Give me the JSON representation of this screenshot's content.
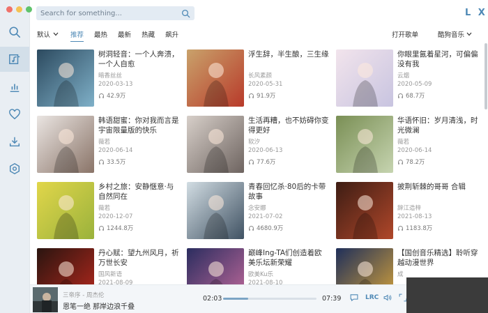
{
  "window": {
    "controls": [
      "#f0726a",
      "#f5c254",
      "#5fc36b"
    ]
  },
  "app_logo": "L X",
  "search": {
    "placeholder": "Search for something..."
  },
  "sidebar": {
    "items": [
      "search-icon",
      "music-list-icon",
      "chart-icon",
      "heart-icon",
      "download-icon",
      "settings-icon"
    ],
    "active": 1
  },
  "sort": {
    "default_label": "默认",
    "tabs": [
      "推荐",
      "最热",
      "最新",
      "热藏",
      "飙升"
    ],
    "active": 0
  },
  "top_right": {
    "open_playlist": "打开歌单",
    "source": "酷狗音乐"
  },
  "cards": [
    {
      "title": "树洞轻音：一个人奔溃，一个人自愈",
      "author": "暗香丝丝",
      "date": "2020-03-13",
      "plays": "42.9万",
      "colors": [
        "#2c4a5f",
        "#7fb0c8"
      ]
    },
    {
      "title": "浮生辞，半生酿，三生缘",
      "author": "长风素颜",
      "date": "2020-05-31",
      "plays": "91.9万",
      "colors": [
        "#c9a26b",
        "#b83a2a"
      ]
    },
    {
      "title": "你眼里氤着星河，可偏偏没有我",
      "author": "云烟",
      "date": "2020-05-09",
      "plays": "68.7万",
      "colors": [
        "#f2e4ec",
        "#c8c4e0"
      ]
    },
    {
      "title": "韩语甜蜜：你对我而言是宇宙限量版的快乐",
      "author": "薇若",
      "date": "2020-06-14",
      "plays": "33.5万",
      "colors": [
        "#eae5e2",
        "#8a7468"
      ]
    },
    {
      "title": "生活再糟，也不妨碍你变得更好",
      "author": "软汐",
      "date": "2020-06-13",
      "plays": "77.6万",
      "colors": [
        "#d7cfc9",
        "#6e6460"
      ]
    },
    {
      "title": "华语怀旧：岁月清浅，时光微澜",
      "author": "薇若",
      "date": "2020-06-14",
      "plays": "78.2万",
      "colors": [
        "#7a8f55",
        "#c6d4b0"
      ]
    },
    {
      "title": "乡村之旅：安静惬意·与自然同在",
      "author": "薇若",
      "date": "2020-12-07",
      "plays": "1244.8万",
      "colors": [
        "#e1d64a",
        "#9ab23c"
      ]
    },
    {
      "title": "青春回忆杀·80后的卡带故事",
      "author": "念安娜",
      "date": "2021-07-02",
      "plays": "4680.9万",
      "colors": [
        "#d2dde3",
        "#405263"
      ]
    },
    {
      "title": "披荆斩棘的哥哥 合辑",
      "author": "辞江造梓",
      "date": "2021-08-13",
      "plays": "1183.8万",
      "colors": [
        "#3d1d14",
        "#b0472a"
      ]
    },
    {
      "title": "丹心赋：望九州风月，祈万世长安",
      "author": "国风新语",
      "date": "2021-08-09",
      "plays": "",
      "colors": [
        "#2a1510",
        "#b8281d"
      ]
    },
    {
      "title": "巅峰Ing-TA们创造着欧美乐坛新荣耀",
      "author": "欧美Ku乐",
      "date": "2021-08-10",
      "plays": "",
      "colors": [
        "#2b2d5f",
        "#c36a9c"
      ]
    },
    {
      "title": "【国创音乐精选】聆听穿越动漫世界",
      "author": "成",
      "date": "",
      "plays": "",
      "colors": [
        "#1f2f5a",
        "#d9a53a"
      ]
    }
  ],
  "player": {
    "song": "三帝序 - 周杰伦",
    "lyric": "恩笔一绝 那岸边浪千叠",
    "current_time": "02:03",
    "total_time": "07:39",
    "progress": 0.27,
    "lrc": "LRC"
  }
}
